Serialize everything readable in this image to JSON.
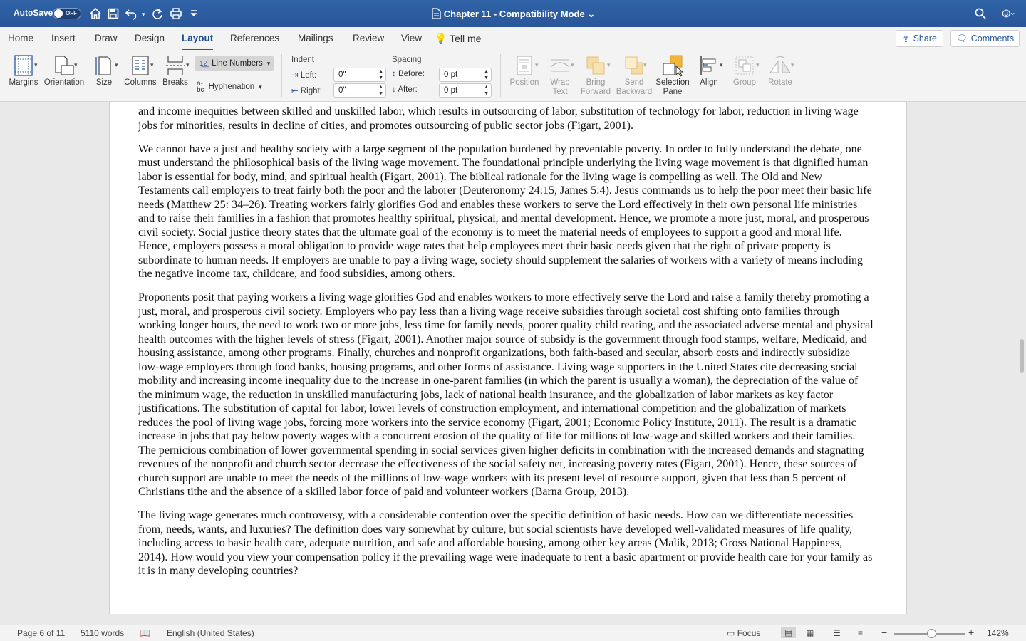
{
  "title_bar": {
    "autosave_label": "AutoSave",
    "autosave_state": "OFF",
    "document_title": "Chapter 11  -  Compatibility Mode",
    "icons": [
      "home-icon",
      "save-icon",
      "undo-icon",
      "redo-icon",
      "print-icon",
      "customize-icon",
      "search-icon",
      "smiley-icon"
    ]
  },
  "ribbon_tabs": [
    "Home",
    "Insert",
    "Draw",
    "Design",
    "Layout",
    "References",
    "Mailings",
    "Review",
    "View"
  ],
  "active_tab": "Layout",
  "tell_me": "Tell me",
  "share_label": "Share",
  "comments_label": "Comments",
  "ribbon": {
    "margins": "Margins",
    "orientation": "Orientation",
    "size": "Size",
    "columns": "Columns",
    "breaks": "Breaks",
    "line_numbers": "Line Numbers",
    "hyphenation": "Hyphenation",
    "indent_title": "Indent",
    "indent_left_label": "Left:",
    "indent_left_value": "0\"",
    "indent_right_label": "Right:",
    "indent_right_value": "0\"",
    "spacing_title": "Spacing",
    "spacing_before_label": "Before:",
    "spacing_before_value": "0 pt",
    "spacing_after_label": "After:",
    "spacing_after_value": "0 pt",
    "position": "Position",
    "wrap_text_1": "Wrap",
    "wrap_text_2": "Text",
    "bring_forward_1": "Bring",
    "bring_forward_2": "Forward",
    "send_backward_1": "Send",
    "send_backward_2": "Backward",
    "selection_pane_1": "Selection",
    "selection_pane_2": "Pane",
    "align": "Align",
    "group": "Group",
    "rotate": "Rotate"
  },
  "document": {
    "paragraphs": [
      "and income inequities between skilled and unskilled labor, which results in outsourcing of labor, substitution of technology for labor, reduction in living wage jobs for minorities, results in decline of cities, and promotes outsourcing of public sector jobs (Figart, 2001).",
      "We cannot have a just and healthy society with a large segment of the population burdened by preventable poverty. In order to fully understand the debate, one must understand the philosophical basis of the living wage movement. The foundational principle underlying the living wage movement is that dignified human labor is essential for body, mind, and spiritual health (Figart, 2001). The biblical rationale for the living wage is compelling as well. The Old and New Testaments call employers to treat fairly both the poor and the laborer (Deuteronomy 24:15, James 5:4). Jesus commands us to help the poor meet their basic life needs (Matthew 25: 34–26). Treating workers fairly glorifies God and enables these workers to serve the Lord effectively in their own personal life ministries and to raise their families in a fashion that promotes healthy spiritual, physical, and mental development. Hence, we promote a more just, moral, and prosperous civil society. Social justice theory states that the ultimate goal of the economy is to meet the material needs of employees to support a good and moral life. Hence, employers possess a moral obligation to provide wage rates that help employees meet their basic needs given that the right of private property is subordinate to human needs. If employers are unable to pay a living wage, society should supplement the salaries of workers with a variety of means including the negative income tax, childcare, and food subsidies, among others.",
      "Proponents posit that paying workers a living wage glorifies God and enables workers to more effectively serve the Lord and raise a family thereby promoting a just, moral, and prosperous civil society. Employers who pay less than a living wage receive subsidies through societal cost shifting onto families through working longer hours, the need to work two or more jobs, less time for family needs, poorer quality child rearing, and the associated adverse mental and physical health outcomes with the higher levels of stress (Figart, 2001). Another major source of subsidy is the government through food stamps, welfare, Medicaid, and housing assistance, among other programs. Finally, churches and nonprofit organizations, both faith-based and secular, absorb costs and indirectly subsidize low-wage employers through food banks, housing programs, and other forms of assistance. Living wage supporters in the United States cite decreasing social mobility and increasing income inequality due to the increase in one-parent families (in which the parent is usually a woman), the depreciation of the value of the minimum wage, the reduction in unskilled manufacturing jobs, lack of national health insurance, and the globalization of labor markets as key factor justifications. The substitution of capital for labor, lower levels of construction employment, and international competition and the globalization of markets reduces the pool of living wage jobs, forcing more workers into the service economy (Figart, 2001; Economic Policy Institute, 2011). The result is a dramatic increase in jobs that pay below poverty wages with a concurrent erosion of the quality of life for millions of low-wage and skilled workers and their families. The pernicious combination of lower governmental spending in social services given higher deficits in combination with the increased demands and stagnating revenues of the nonprofit and church sector decrease the effectiveness of the social safety net, increasing poverty rates (Figart, 2001). Hence, these sources of church support are unable to meet the needs of the millions of low-wage workers with its present level of resource support, given that less than 5 percent of Christians tithe and the absence of a skilled labor force of paid and volunteer workers (Barna Group, 2013).",
      "The living wage generates much controversy, with a considerable contention over the specific definition of basic needs. How can we differentiate necessities from, needs, wants, and luxuries? The definition does vary somewhat by culture, but social scientists have developed well-validated measures of life quality, including access to basic health care, adequate nutrition, and safe and affordable housing, among other key areas (Malik, 2013; Gross National Happiness, 2014). How would you view your compensation policy if the prevailing wage were inadequate to rent a basic apartment or provide health care for your family as it is in many developing countries?"
    ]
  },
  "status_bar": {
    "page": "Page 6 of 11",
    "words": "5110 words",
    "language": "English (United States)",
    "focus": "Focus",
    "zoom": "142%",
    "zoom_level_fraction": 0.46
  }
}
